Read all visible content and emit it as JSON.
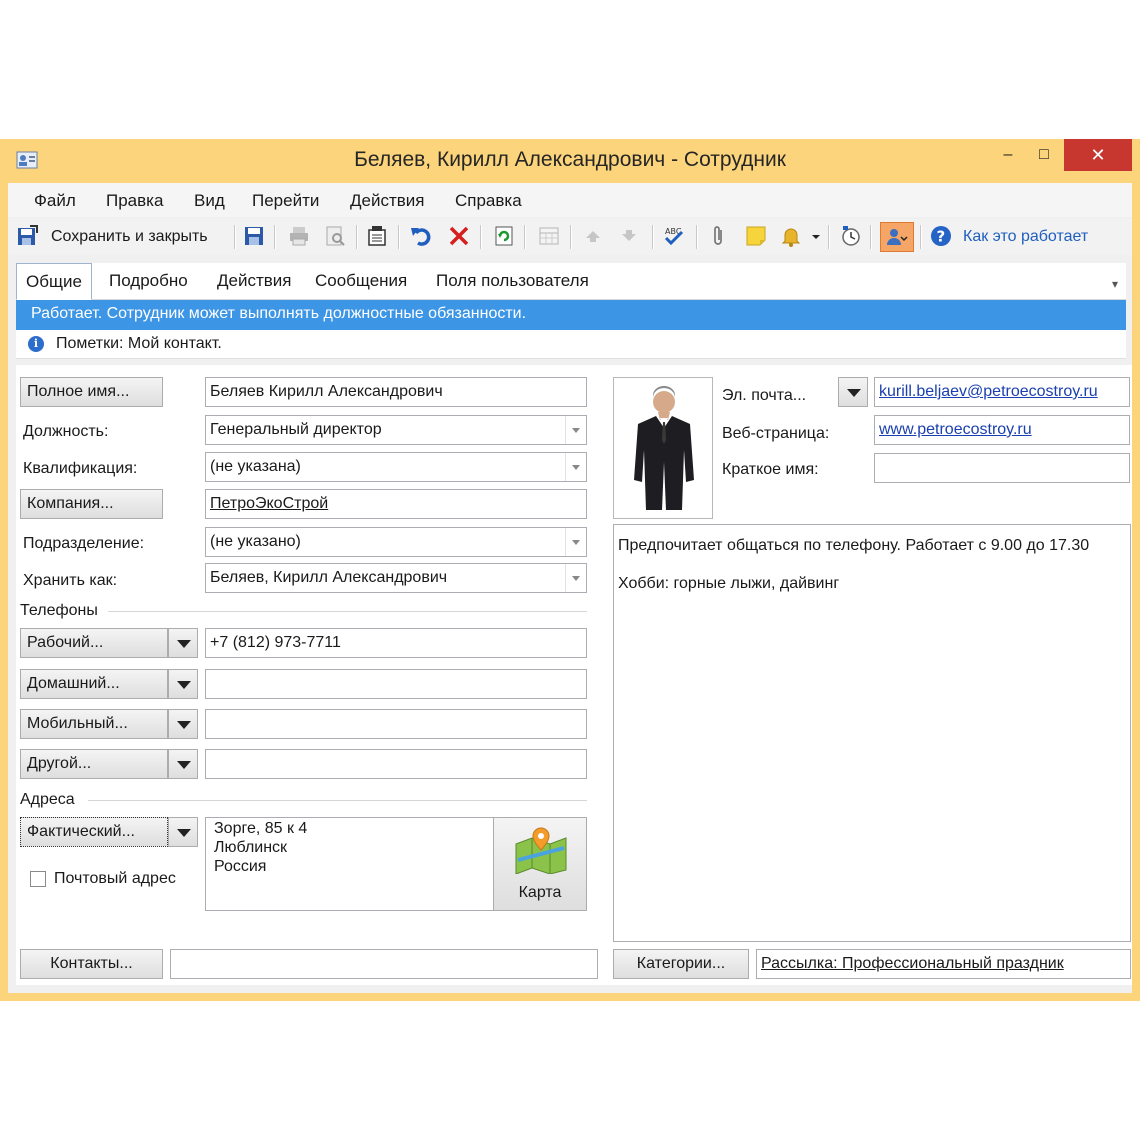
{
  "window": {
    "title": "Беляев, Кирилл Александрович - Сотрудник",
    "minimize": "–",
    "maximize": "□",
    "close": "✕"
  },
  "menu": [
    "Файл",
    "Правка",
    "Вид",
    "Перейти",
    "Действия",
    "Справка"
  ],
  "toolbar": {
    "save_close": "Сохранить и закрыть",
    "help": "Как это работает"
  },
  "tabs": [
    "Общие",
    "Подробно",
    "Действия",
    "Сообщения",
    "Поля пользователя"
  ],
  "status": "Работает. Сотрудник может выполнять должностные обязанности.",
  "note": "Пометки: Мой контакт.",
  "form": {
    "full_name_button": "Полное имя...",
    "full_name": "Беляев Кирилл Александрович",
    "position_label": "Должность:",
    "position": "Генеральный директор",
    "qualification_label": "Квалификация:",
    "qualification": "(не указана)",
    "company_button": "Компания...",
    "company": "ПетроЭкоСтрой",
    "department_label": "Подразделение:",
    "department": "(не указано)",
    "store_as_label": "Хранить как:",
    "store_as": "Беляев, Кирилл Александрович",
    "phones_section": "Телефоны",
    "phone_work_button": "Рабочий...",
    "phone_work": "+7 (812) 973-7711",
    "phone_home_button": "Домашний...",
    "phone_home": "",
    "phone_mobile_button": "Мобильный...",
    "phone_mobile": "",
    "phone_other_button": "Другой...",
    "phone_other": "",
    "addresses_section": "Адреса",
    "address_button": "Фактический...",
    "address_lines": [
      "Зорге, 85 к 4",
      "Люблинск",
      "Россия"
    ],
    "postal_address_label": "Почтовый адрес",
    "map_button": "Карта",
    "email_label": "Эл. почта...",
    "email": "kurill.beljaev@petroecostroy.ru",
    "web_label": "Веб-страница:",
    "web": "www.petroecostroy.ru",
    "short_name_label": "Краткое имя:",
    "short_name": "",
    "notes_lines": [
      "Предпочитает общаться по телефону. Работает с 9.00 до 17.30",
      "Хобби: горные лыжи, дайвинг"
    ],
    "contacts_button": "Контакты...",
    "contacts_value": "",
    "categories_button": "Категории...",
    "categories_value": "Рассылка: Профессиональный праздник"
  }
}
